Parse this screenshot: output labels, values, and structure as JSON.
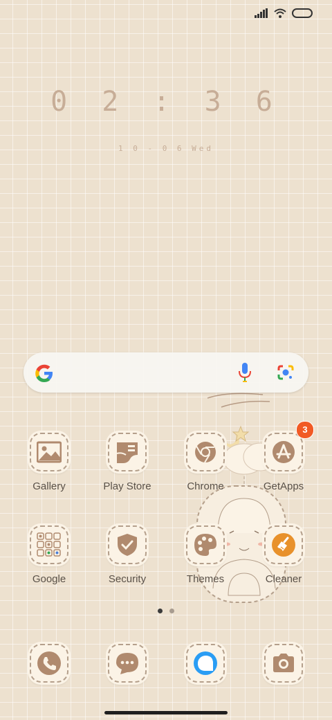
{
  "status_bar": {
    "icons": [
      "signal-icon",
      "wifi-icon",
      "battery-icon"
    ]
  },
  "clock": {
    "time": "0 2 : 3 6",
    "date": "1 0 - 0 6  Wed"
  },
  "search_bar": {
    "icons": [
      "google-logo-icon",
      "mic-icon",
      "lens-icon"
    ]
  },
  "apps_row1": [
    {
      "label": "Gallery",
      "icon": "gallery-icon"
    },
    {
      "label": "Play Store",
      "icon": "play-store-icon"
    },
    {
      "label": "Chrome",
      "icon": "chrome-icon"
    },
    {
      "label": "GetApps",
      "icon": "getapps-icon",
      "badge": "3"
    }
  ],
  "apps_row2": [
    {
      "label": "Google",
      "icon": "google-folder-icon"
    },
    {
      "label": "Security",
      "icon": "security-shield-icon"
    },
    {
      "label": "Themes",
      "icon": "themes-palette-icon"
    },
    {
      "label": "Cleaner",
      "icon": "cleaner-broom-icon"
    }
  ],
  "dock": [
    {
      "icon": "phone-icon"
    },
    {
      "icon": "messages-icon"
    },
    {
      "icon": "browser-icon"
    },
    {
      "icon": "camera-icon"
    }
  ],
  "page_indicator": {
    "pages": 2,
    "active": 1
  },
  "colors": {
    "background": "#ede1cf",
    "accent": "#b08a6e",
    "badge": "#f15a24",
    "cleaner": "#e8912b"
  }
}
